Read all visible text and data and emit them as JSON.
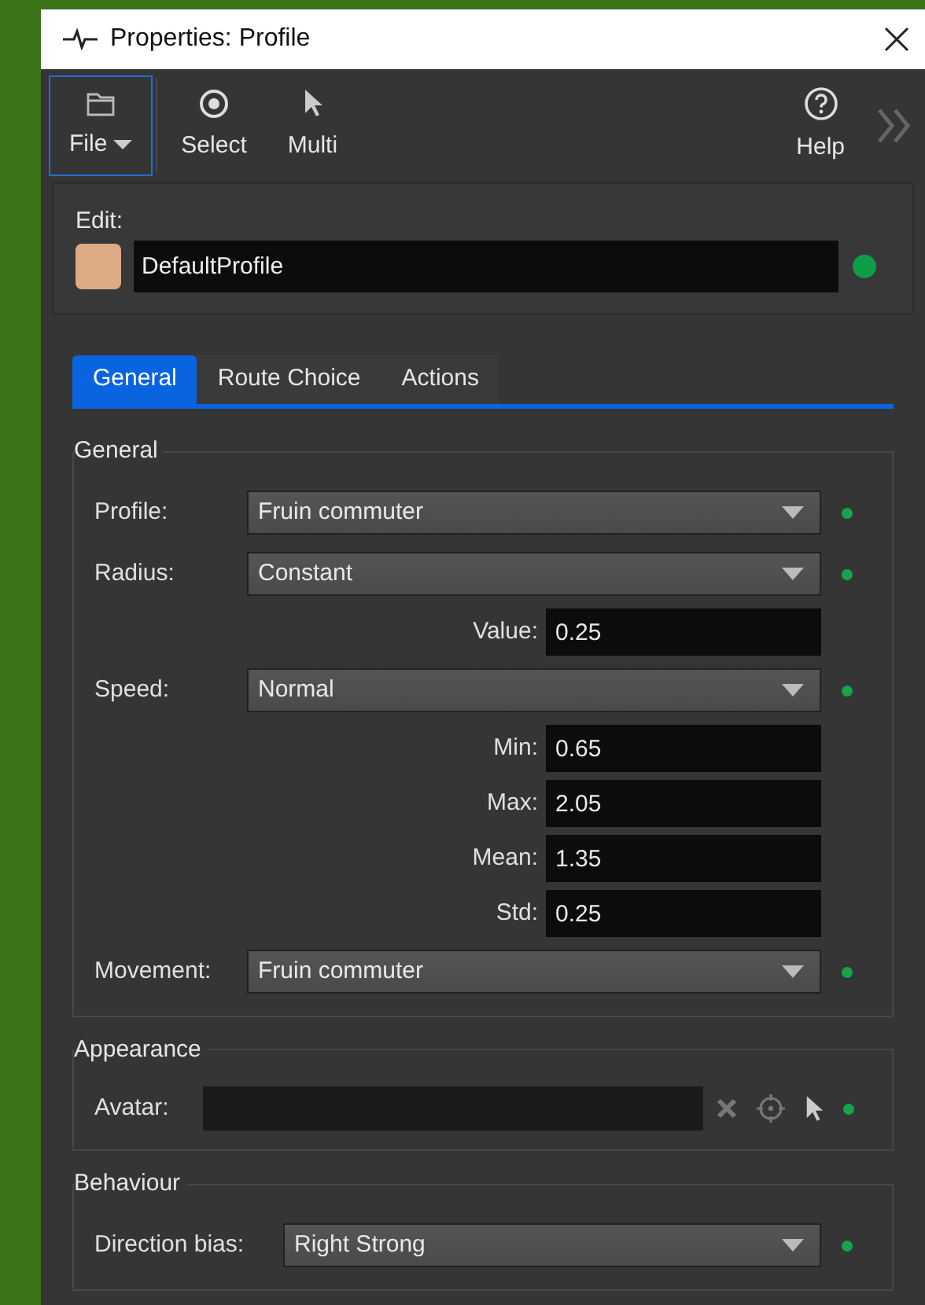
{
  "window": {
    "title": "Properties: Profile"
  },
  "toolbar": {
    "left": [
      {
        "label": "File",
        "kind": "menu",
        "selected": true
      },
      {
        "label": "Select",
        "kind": "target",
        "selected": false
      },
      {
        "label": "Multi",
        "kind": "pointer",
        "selected": false
      }
    ],
    "right": [
      {
        "label": "Help",
        "kind": "help",
        "selected": false
      }
    ]
  },
  "edit": {
    "label": "Edit:",
    "value": "DefaultProfile",
    "swatch": {
      "color": "#dcaa84"
    },
    "color": "#0f9d48"
  },
  "tabs": [
    {
      "label": "General",
      "selected": true
    },
    {
      "label": "Route Choice",
      "selected": false
    },
    {
      "label": "Actions",
      "selected": false
    }
  ],
  "groups": [
    {
      "title": "General",
      "rows": [
        {
          "kind": "dropdown",
          "label": "Profile:",
          "value": "Fruin commuter",
          "color": "#16a34a"
        },
        {
          "kind": "dropdown",
          "label": "Radius:",
          "value": "Constant",
          "color": "#16a34a"
        },
        {
          "kind": "number",
          "label": "Value:",
          "value": "0.25"
        },
        {
          "kind": "dropdown",
          "label": "Speed:",
          "value": "Normal",
          "color": "#16a34a"
        },
        {
          "kind": "number",
          "label": "Min:",
          "value": "0.65"
        },
        {
          "kind": "number",
          "label": "Max:",
          "value": "2.05"
        },
        {
          "kind": "number",
          "label": "Mean:",
          "value": "1.35"
        },
        {
          "kind": "number",
          "label": "Std:",
          "value": "0.25"
        },
        {
          "kind": "dropdown",
          "label": "Movement:",
          "value": "Fruin commuter",
          "color": "#16a34a"
        }
      ]
    },
    {
      "title": "Appearance",
      "rows": [
        {
          "kind": "picker",
          "label": "Avatar:",
          "color": "#16a34a"
        }
      ]
    },
    {
      "title": "Behaviour",
      "rows": [
        {
          "kind": "dropdown",
          "label": "Direction bias:",
          "value": "Right Strong",
          "color": "#16a34a"
        }
      ]
    }
  ]
}
